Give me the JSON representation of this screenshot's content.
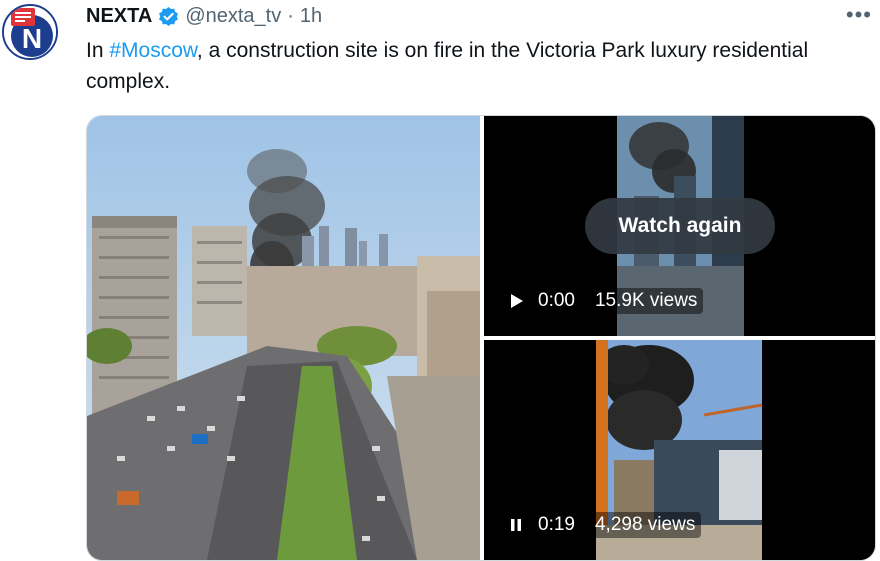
{
  "author": {
    "name": "NEXTA",
    "handle": "@nexta_tv",
    "separator": "·",
    "time": "1h",
    "avatar_letter": "N"
  },
  "more_icon": "•••",
  "tweet": {
    "prefix": "In ",
    "hashtag": "#Moscow",
    "suffix": ", a construction site is on fire in the Victoria Park luxury residential complex."
  },
  "videos": [
    {
      "overlay_label": "Watch again",
      "control_icon": "play-icon",
      "timestamp": "0:00",
      "views": "15.9K views"
    },
    {
      "control_icon": "pause-icon",
      "timestamp": "0:19",
      "views": "4,298 views"
    }
  ],
  "colors": {
    "accent": "#1d9bf0",
    "text": "#0f1419",
    "muted": "#536471",
    "border": "#cfd9de",
    "logo_red": "#e0343a",
    "logo_blue": "#1d3d8f"
  }
}
